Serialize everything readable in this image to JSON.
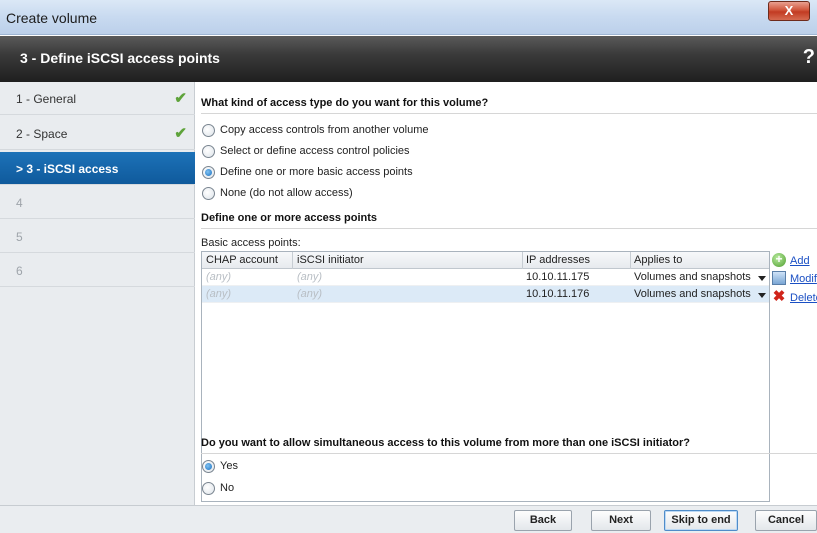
{
  "window": {
    "title": "Create volume",
    "close_label": "X"
  },
  "header": {
    "step_title": "3 - Define iSCSI access points",
    "help_label": "?"
  },
  "sidebar": {
    "items": [
      {
        "label": "1 - General",
        "state": "done"
      },
      {
        "label": "2 - Space",
        "state": "done"
      },
      {
        "label": "> 3 - iSCSI access",
        "state": "active"
      },
      {
        "label": "4",
        "state": "disabled"
      },
      {
        "label": "5",
        "state": "disabled"
      },
      {
        "label": "6",
        "state": "disabled"
      }
    ],
    "check_symbol": "✔"
  },
  "access_type": {
    "question": "What kind of access type do you want for this volume?",
    "options": [
      {
        "label": "Copy access controls from another volume",
        "checked": false
      },
      {
        "label": "Select or define access control policies",
        "checked": false
      },
      {
        "label": "Define one or more basic access points",
        "checked": true
      },
      {
        "label": "None (do not allow access)",
        "checked": false
      }
    ]
  },
  "access_points": {
    "heading": "Define one or more access points",
    "sub_label": "Basic access points:",
    "columns": [
      "CHAP account",
      "iSCSI initiator",
      "IP addresses",
      "Applies to"
    ],
    "rows": [
      {
        "chap": "(any)",
        "initiator": "(any)",
        "ip": "10.10.11.175",
        "applies": "Volumes and snapshots",
        "selected": false
      },
      {
        "chap": "(any)",
        "initiator": "(any)",
        "ip": "10.10.11.176",
        "applies": "Volumes and snapshots",
        "selected": true
      }
    ],
    "actions": {
      "add": "Add",
      "modify": "Modif",
      "delete": "Delete"
    }
  },
  "simultaneous": {
    "question": "Do you want to allow simultaneous access to this volume from more than one iSCSI initiator?",
    "options": [
      {
        "label": "Yes",
        "checked": true
      },
      {
        "label": "No",
        "checked": false
      }
    ]
  },
  "footer": {
    "back": "Back",
    "next": "Next",
    "skip": "Skip to end",
    "cancel": "Cancel"
  },
  "colors": {
    "active_nav": "#1d72b8",
    "header_bg": "#2e2e2e",
    "link": "#1a4fc4",
    "check": "#5ea33a",
    "delete": "#d0241a"
  }
}
